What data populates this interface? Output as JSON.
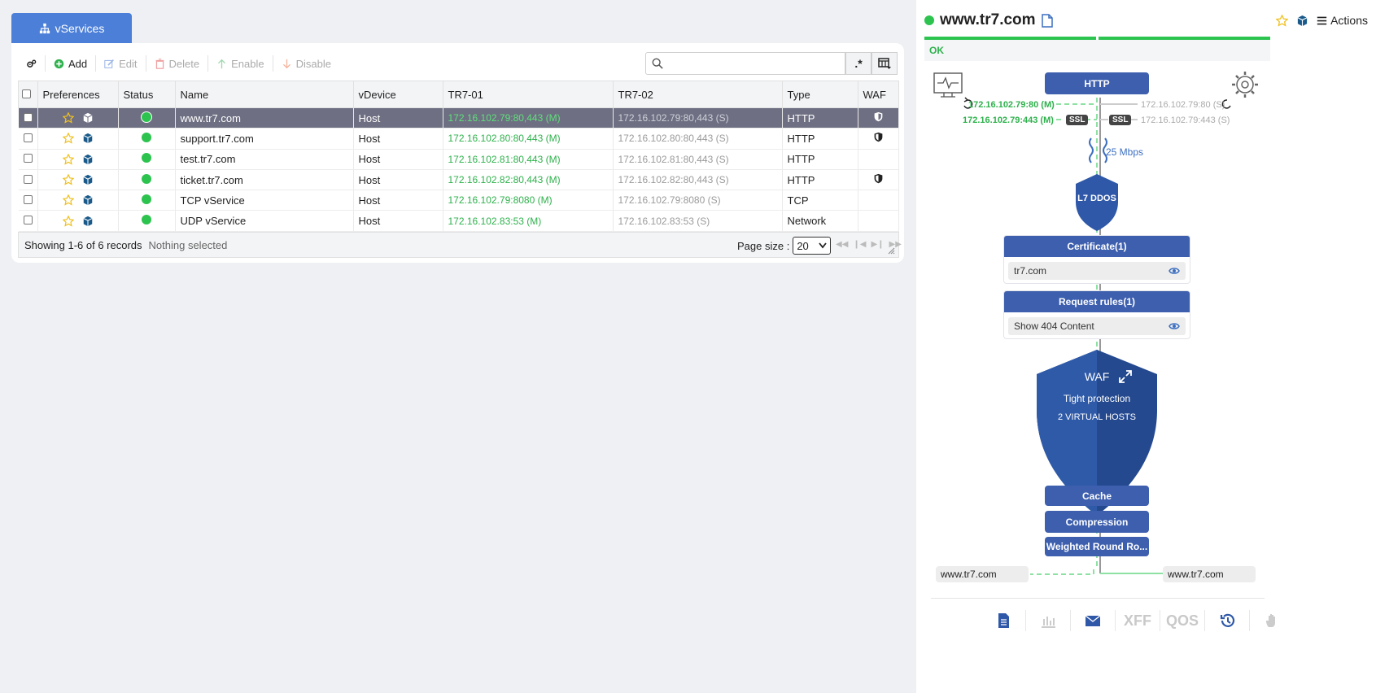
{
  "tab": {
    "label": "vServices"
  },
  "toolbar": {
    "add": "Add",
    "edit": "Edit",
    "delete": "Delete",
    "enable": "Enable",
    "disable": "Disable"
  },
  "search": {
    "placeholder": "",
    "value": ""
  },
  "table": {
    "columns": [
      "Preferences",
      "Status",
      "Name",
      "vDevice",
      "TR7-01",
      "TR7-02",
      "Type",
      "WAF"
    ],
    "rows": [
      {
        "name": "www.tr7.com",
        "vdevice": "Host",
        "tr701": "172.16.102.79:80,443 (M)",
        "tr702": "172.16.102.79:80,443 (S)",
        "type": "HTTP",
        "waf": true,
        "selected": true
      },
      {
        "name": "support.tr7.com",
        "vdevice": "Host",
        "tr701": "172.16.102.80:80,443 (M)",
        "tr702": "172.16.102.80:80,443 (S)",
        "type": "HTTP",
        "waf": true,
        "selected": false
      },
      {
        "name": "test.tr7.com",
        "vdevice": "Host",
        "tr701": "172.16.102.81:80,443 (M)",
        "tr702": "172.16.102.81:80,443 (S)",
        "type": "HTTP",
        "waf": false,
        "selected": false
      },
      {
        "name": "ticket.tr7.com",
        "vdevice": "Host",
        "tr701": "172.16.102.82:80,443 (M)",
        "tr702": "172.16.102.82:80,443 (S)",
        "type": "HTTP",
        "waf": true,
        "selected": false
      },
      {
        "name": "TCP vService",
        "vdevice": "Host",
        "tr701": "172.16.102.79:8080 (M)",
        "tr702": "172.16.102.79:8080 (S)",
        "type": "TCP",
        "waf": false,
        "selected": false
      },
      {
        "name": "UDP vService",
        "vdevice": "Host",
        "tr701": "172.16.102.83:53 (M)",
        "tr702": "172.16.102.83:53 (S)",
        "type": "Network",
        "waf": false,
        "selected": false
      }
    ]
  },
  "footer": {
    "records": "Showing 1-6 of 6 records",
    "selection": "Nothing selected",
    "page_size_label": "Page size :",
    "page_size": "20"
  },
  "detail": {
    "title": "www.tr7.com",
    "actions": "Actions",
    "status": "OK",
    "protocol": "HTTP",
    "ip_m_80": "172.16.102.79:80 (M)",
    "ip_m_443": "172.16.102.79:443 (M)",
    "ip_s_80": "172.16.102.79:80 (S)",
    "ip_s_443": "172.16.102.79:443 (S)",
    "ssl": "SSL",
    "bandwidth": "25 Mbps",
    "ddos": "L7 DDOS",
    "certificate": {
      "header": "Certificate(1)",
      "item": "tr7.com"
    },
    "request_rules": {
      "header": "Request rules(1)",
      "item": "Show 404 Content"
    },
    "waf": {
      "title": "WAF",
      "mode": "Tight protection",
      "hosts": "2 VIRTUAL HOSTS"
    },
    "cache": "Cache",
    "compression": "Compression",
    "lb": "Weighted Round Ro...",
    "host_left": "www.tr7.com",
    "host_right": "www.tr7.com",
    "bottom": {
      "xff": "XFF",
      "qos": "QOS"
    }
  },
  "colors": {
    "accent": "#4c7fd8",
    "box": "#3d5fae",
    "ok": "#2dc34f",
    "selected_row": "#6e6f82"
  }
}
